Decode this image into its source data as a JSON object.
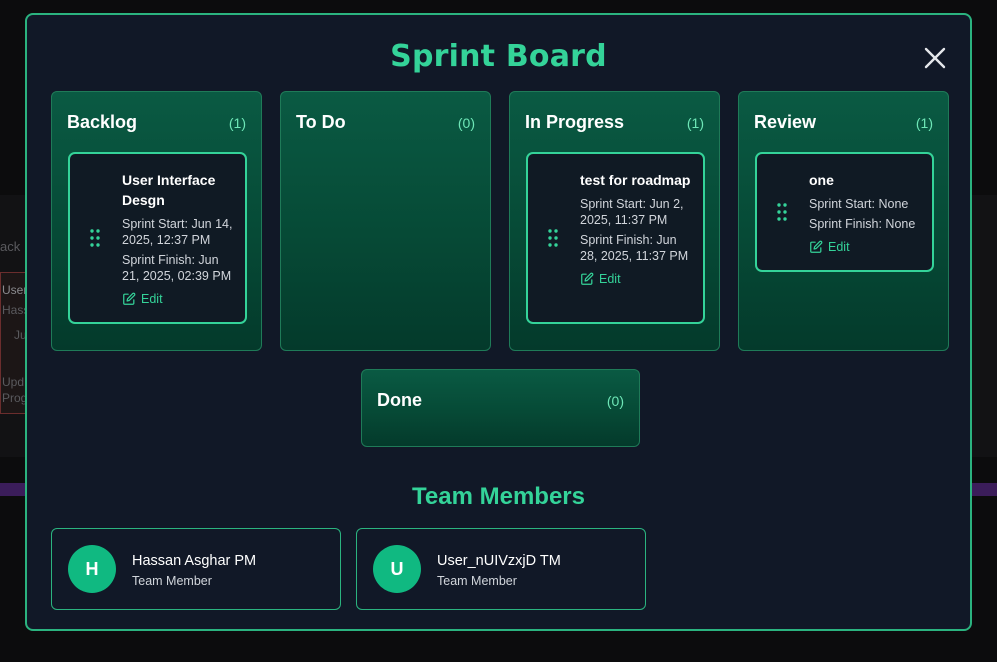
{
  "background": {
    "fragments": [
      "ack",
      "User",
      "Hass",
      "Ju",
      "Upd",
      "Prog"
    ]
  },
  "modal": {
    "title": "Sprint Board",
    "close_icon": "close-icon"
  },
  "columns": [
    {
      "title": "Backlog",
      "count": "(1)",
      "cards": [
        {
          "title": "User Interface Desgn",
          "start": "Sprint Start: Jun 14, 2025, 12:37 PM",
          "finish": "Sprint Finish: Jun 21, 2025, 02:39 PM",
          "edit": "Edit"
        }
      ]
    },
    {
      "title": "To Do",
      "count": "(0)",
      "cards": []
    },
    {
      "title": "In Progress",
      "count": "(1)",
      "cards": [
        {
          "title": "test for roadmap",
          "start": "Sprint Start: Jun 2, 2025, 11:37 PM",
          "finish": "Sprint Finish: Jun 28, 2025, 11:37 PM",
          "edit": "Edit"
        }
      ]
    },
    {
      "title": "Review",
      "count": "(1)",
      "cards": [
        {
          "title": "one",
          "start": "Sprint Start: None",
          "finish": "Sprint Finish: None",
          "edit": "Edit"
        }
      ]
    },
    {
      "title": "Done",
      "count": "(0)",
      "cards": []
    }
  ],
  "team": {
    "title": "Team Members",
    "members": [
      {
        "initial": "H",
        "name": "Hassan Asghar PM",
        "role": "Team Member"
      },
      {
        "initial": "U",
        "name": "User_nUIVzxjD TM",
        "role": "Team Member"
      }
    ]
  },
  "colors": {
    "accent": "#34d399",
    "avatar": "#10b981",
    "modal_bg": "#111827",
    "column_bg": "#0a5a43"
  }
}
